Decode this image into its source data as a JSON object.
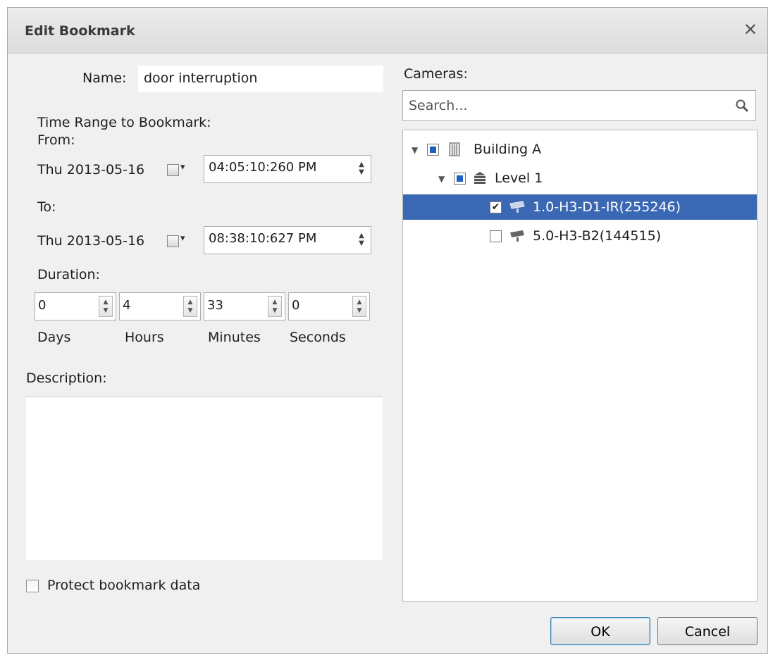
{
  "dialog": {
    "title": "Edit Bookmark",
    "close_glyph": "✕"
  },
  "form": {
    "name_label": "Name:",
    "name_value": "door interruption",
    "time_range_label": "Time Range to Bookmark:",
    "from_label": "From:",
    "from_date": "Thu 2013-05-16",
    "from_time": "04:05:10:260  PM",
    "to_label": "To:",
    "to_date": "Thu 2013-05-16",
    "to_time": "08:38:10:627  PM",
    "duration_label": "Duration:",
    "duration": {
      "days": "0",
      "hours": "4",
      "minutes": "33",
      "seconds": "0",
      "days_label": "Days",
      "hours_label": "Hours",
      "minutes_label": "Minutes",
      "seconds_label": "Seconds"
    },
    "description_label": "Description:",
    "description_value": "",
    "protect_label": "Protect bookmark data",
    "protect_checked": false
  },
  "cameras": {
    "label": "Cameras:",
    "search_placeholder": "Search...",
    "tree": [
      {
        "label": "Building A",
        "level": 0,
        "state": "partial",
        "icon": "building-icon"
      },
      {
        "label": "Level 1",
        "level": 1,
        "state": "partial",
        "icon": "floor-icon"
      },
      {
        "label": "1.0-H3-D1-IR(255246)",
        "level": 2,
        "state": "checked",
        "icon": "camera-icon",
        "selected": true
      },
      {
        "label": "5.0-H3-B2(144515)",
        "level": 2,
        "state": "unchecked",
        "icon": "camera-icon",
        "selected": false
      }
    ]
  },
  "buttons": {
    "ok": "OK",
    "cancel": "Cancel"
  },
  "colors": {
    "selection": "#3b68b3",
    "checkbox_fill": "#1e5fc4",
    "dialog_bg": "#f0f0f0"
  }
}
